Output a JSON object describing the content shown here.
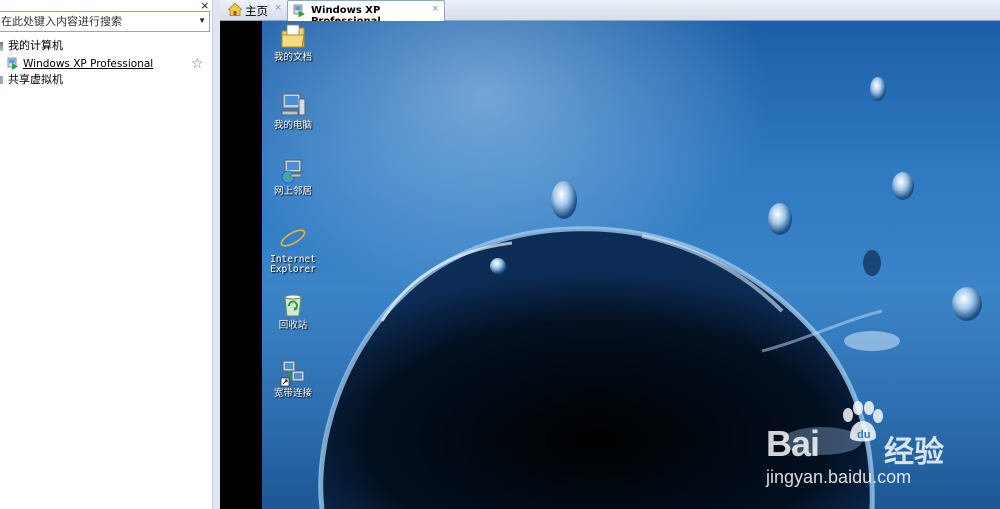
{
  "library": {
    "close_glyph": "×",
    "search_placeholder": "在此处键入内容进行搜索",
    "dropdown_glyph": "▼",
    "tree": {
      "my_computer": "我的计算机",
      "vm_name": "Windows XP Professional",
      "star_glyph": "☆",
      "shared_vms": "共享虚拟机"
    }
  },
  "tabs": [
    {
      "label": "主页",
      "close": "×",
      "icon": "home-icon"
    },
    {
      "label": "Windows XP Professional",
      "close": "×",
      "icon": "vm-icon",
      "active": true
    }
  ],
  "desktop": {
    "icons": [
      {
        "label": "我的文档",
        "icon": "my-documents-icon"
      },
      {
        "label": "我的电脑",
        "icon": "my-computer-icon"
      },
      {
        "label": "网上邻居",
        "icon": "network-places-icon"
      },
      {
        "label_line1": "Internet",
        "label_line2": "Explorer",
        "icon": "internet-explorer-icon"
      },
      {
        "label": "回收站",
        "icon": "recycle-bin-icon"
      },
      {
        "label": "宽带连接",
        "icon": "broadband-connection-icon"
      }
    ]
  },
  "watermark": {
    "brand": "Bai",
    "brand2": "经验",
    "url": "jingyan.baidu.com"
  },
  "colors": {
    "border_accent": "#8ea6c2",
    "tab_bar": "#d6deea",
    "desktop_blue": "#2f79c1"
  }
}
